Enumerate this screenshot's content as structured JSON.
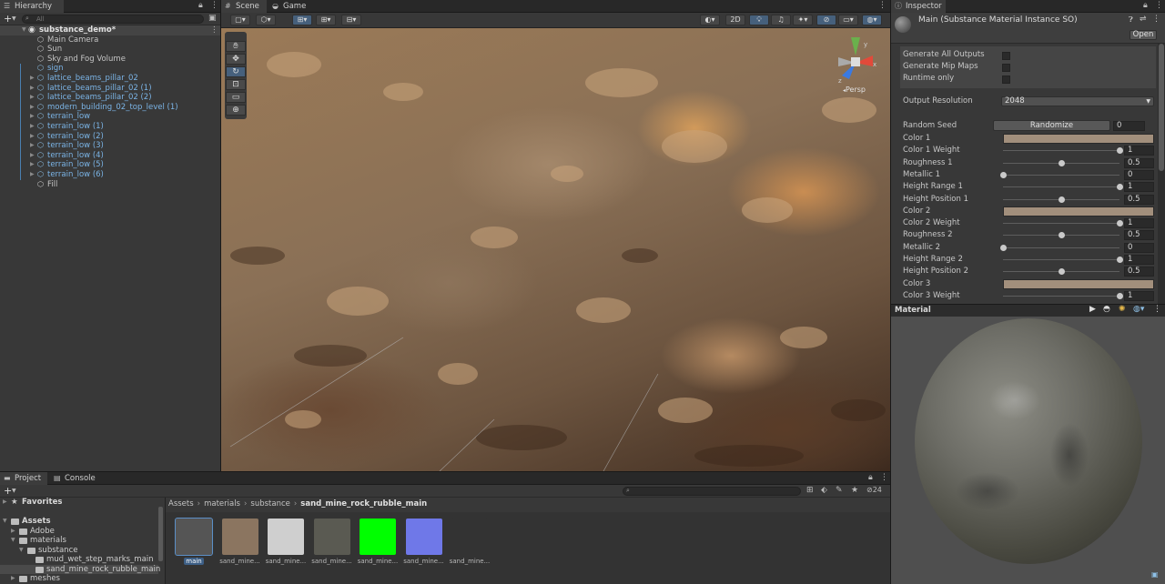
{
  "hierarchy": {
    "tab": "Hierarchy",
    "search_placeholder": "All",
    "scene_name": "substance_demo*",
    "items": [
      {
        "label": "Main Camera",
        "prefab": false,
        "arrow": false
      },
      {
        "label": "Sun",
        "prefab": false,
        "arrow": false
      },
      {
        "label": "Sky and Fog Volume",
        "prefab": false,
        "arrow": false
      },
      {
        "label": "sign",
        "prefab": true,
        "arrow": false
      },
      {
        "label": "lattice_beams_pillar_02",
        "prefab": true,
        "arrow": true
      },
      {
        "label": "lattice_beams_pillar_02 (1)",
        "prefab": true,
        "arrow": true
      },
      {
        "label": "lattice_beams_pillar_02 (2)",
        "prefab": true,
        "arrow": true
      },
      {
        "label": "modern_building_02_top_level (1)",
        "prefab": true,
        "arrow": true
      },
      {
        "label": "terrain_low",
        "prefab": true,
        "arrow": true
      },
      {
        "label": "terrain_low (1)",
        "prefab": true,
        "arrow": true
      },
      {
        "label": "terrain_low (2)",
        "prefab": true,
        "arrow": true
      },
      {
        "label": "terrain_low (3)",
        "prefab": true,
        "arrow": true
      },
      {
        "label": "terrain_low (4)",
        "prefab": true,
        "arrow": true
      },
      {
        "label": "terrain_low (5)",
        "prefab": true,
        "arrow": true
      },
      {
        "label": "terrain_low (6)",
        "prefab": true,
        "arrow": true
      },
      {
        "label": "Fill",
        "prefab": false,
        "arrow": false
      }
    ]
  },
  "scene": {
    "tab_scene": "Scene",
    "tab_game": "Game",
    "btn_2d": "2D",
    "persp": "Persp",
    "gizmo_axes": {
      "x": "x",
      "y": "y",
      "z": "z"
    }
  },
  "inspector": {
    "tab": "Inspector",
    "title": "Main (Substance Material Instance SO)",
    "open_label": "Open",
    "checkboxes": [
      "Generate All Outputs",
      "Generate Mip Maps",
      "Runtime only"
    ],
    "output_resolution_label": "Output Resolution",
    "output_resolution_value": "2048",
    "random_seed_label": "Random Seed",
    "randomize_label": "Randomize",
    "random_seed_value": "0",
    "params": [
      {
        "label": "Color 1",
        "kind": "color",
        "color": "#a28f7c"
      },
      {
        "label": "Color 1 Weight",
        "kind": "slider",
        "value": 1,
        "text": "1"
      },
      {
        "label": "Roughness 1",
        "kind": "slider",
        "value": 0.5,
        "text": "0.5"
      },
      {
        "label": "Metallic 1",
        "kind": "slider",
        "value": 0,
        "text": "0"
      },
      {
        "label": "Height Range 1",
        "kind": "slider",
        "value": 1,
        "text": "1"
      },
      {
        "label": "Height Position 1",
        "kind": "slider",
        "value": 0.5,
        "text": "0.5"
      },
      {
        "label": "Color 2",
        "kind": "color",
        "color": "#a28f7c"
      },
      {
        "label": "Color 2 Weight",
        "kind": "slider",
        "value": 1,
        "text": "1"
      },
      {
        "label": "Roughness 2",
        "kind": "slider",
        "value": 0.5,
        "text": "0.5"
      },
      {
        "label": "Metallic 2",
        "kind": "slider",
        "value": 0,
        "text": "0"
      },
      {
        "label": "Height Range 2",
        "kind": "slider",
        "value": 1,
        "text": "1"
      },
      {
        "label": "Height Position 2",
        "kind": "slider",
        "value": 0.5,
        "text": "0.5"
      },
      {
        "label": "Color 3",
        "kind": "color",
        "color": "#a28f7c"
      },
      {
        "label": "Color 3 Weight",
        "kind": "slider",
        "value": 1,
        "text": "1"
      }
    ],
    "material_label": "Material"
  },
  "project": {
    "tab_project": "Project",
    "tab_console": "Console",
    "favorites": "Favorites",
    "assets": "Assets",
    "tree": [
      {
        "label": "Adobe",
        "depth": 1
      },
      {
        "label": "materials",
        "depth": 1
      },
      {
        "label": "substance",
        "depth": 2
      },
      {
        "label": "mud_wet_step_marks_main",
        "depth": 3
      },
      {
        "label": "sand_mine_rock_rubble_main",
        "depth": 3,
        "selected": true
      },
      {
        "label": "meshes",
        "depth": 1
      }
    ],
    "breadcrumb": [
      "Assets",
      "materials",
      "substance",
      "sand_mine_rock_rubble_main"
    ],
    "hidden_count": "24",
    "thumbnails": [
      {
        "label": "main",
        "color": "#555",
        "selected": true
      },
      {
        "label": "sand_mine...",
        "color": "#8b7560"
      },
      {
        "label": "sand_mine...",
        "color": "#cfcfcf"
      },
      {
        "label": "sand_mine...",
        "color": "#5a5a52"
      },
      {
        "label": "sand_mine...",
        "color": "#00ff00"
      },
      {
        "label": "sand_mine...",
        "color": "#6f78e8"
      },
      {
        "label": "sand_mine...",
        "color": "#333333"
      }
    ]
  },
  "colors": {
    "panel": "#383838",
    "selection": "#2c5d87",
    "prefab_blue": "#7bb4e6"
  }
}
